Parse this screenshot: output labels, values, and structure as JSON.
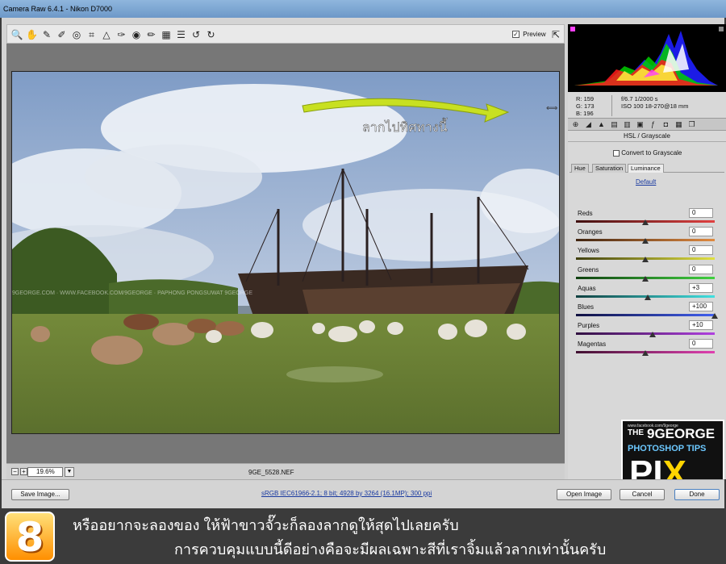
{
  "window": {
    "title": "Camera Raw 6.4.1  -  Nikon D7000"
  },
  "toolbar": {
    "tools": [
      {
        "name": "zoom-tool-icon",
        "glyph": "🔍"
      },
      {
        "name": "hand-tool-icon",
        "glyph": "✋"
      },
      {
        "name": "white-balance-tool-icon",
        "glyph": "✎"
      },
      {
        "name": "color-sampler-tool-icon",
        "glyph": "✐"
      },
      {
        "name": "targeted-adjustment-tool-icon",
        "glyph": "◎"
      },
      {
        "name": "crop-tool-icon",
        "glyph": "⌗"
      },
      {
        "name": "straighten-tool-icon",
        "glyph": "△"
      },
      {
        "name": "spot-removal-tool-icon",
        "glyph": "✑"
      },
      {
        "name": "red-eye-tool-icon",
        "glyph": "◉"
      },
      {
        "name": "adjustment-brush-icon",
        "glyph": "✏"
      },
      {
        "name": "graduated-filter-icon",
        "glyph": "▦"
      },
      {
        "name": "preferences-icon",
        "glyph": "☰"
      },
      {
        "name": "rotate-left-icon",
        "glyph": "↺"
      },
      {
        "name": "rotate-right-icon",
        "glyph": "↻"
      }
    ],
    "preview_label": "Preview",
    "preview_checked": "✓"
  },
  "annotation": {
    "text": "ลากไปทิศทางนี้"
  },
  "watermark": {
    "text": "9GEORGE.COM · WWW.FACEBOOK.COM/9GEORGE · PAPHONG PONGSUWAT 9GEORGE"
  },
  "viewer_footer": {
    "zoom_minus": "−",
    "zoom_plus": "+",
    "zoom_value": "19.6%",
    "zoom_dropdown": "▼",
    "filename": "9GE_5528.NEF"
  },
  "info": {
    "rgb": {
      "r": "R:  159",
      "g": "G:  173",
      "b": "B:  196"
    },
    "camera": {
      "line1": "f/6.7    1/2000 s",
      "line2": "ISO 100   18-270@18 mm"
    }
  },
  "panel": {
    "title": "HSL / Grayscale",
    "convert_label": "Convert to Grayscale",
    "tabs": [
      "Hue",
      "Saturation",
      "Luminance"
    ],
    "default_link": "Default",
    "sliders": [
      {
        "label": "Reds",
        "value": "0",
        "pos": 0.5,
        "track": "linear-gradient(90deg,#401010,#e04040)"
      },
      {
        "label": "Oranges",
        "value": "0",
        "pos": 0.5,
        "track": "linear-gradient(90deg,#402410,#e08a40)"
      },
      {
        "label": "Yellows",
        "value": "0",
        "pos": 0.5,
        "track": "linear-gradient(90deg,#404010,#e0e040)"
      },
      {
        "label": "Greens",
        "value": "0",
        "pos": 0.5,
        "track": "linear-gradient(90deg,#104010,#40d040)"
      },
      {
        "label": "Aquas",
        "value": "+3",
        "pos": 0.515,
        "track": "linear-gradient(90deg,#104040,#40e0e0)"
      },
      {
        "label": "Blues",
        "value": "+100",
        "pos": 1.0,
        "track": "linear-gradient(90deg,#101040,#4060f0)"
      },
      {
        "label": "Purples",
        "value": "+10",
        "pos": 0.55,
        "track": "linear-gradient(90deg,#301040,#b040e0)"
      },
      {
        "label": "Magentas",
        "value": "0",
        "pos": 0.5,
        "track": "linear-gradient(90deg,#401030,#e040b0)"
      }
    ]
  },
  "bottom": {
    "save_button": "Save Image...",
    "workflow_link": "sRGB IEC61966-2.1; 8 bit; 4928 by 3264 (16.1MP); 300 ppi",
    "open_button": "Open Image",
    "cancel_button": "Cancel",
    "done_button": "Done"
  },
  "banner": {
    "step": "8",
    "line1": "หรืออยากจะลองของ ให้ฟ้าขาวจั๊วะก็ลองลากดูให้สุดไปเลยครับ",
    "line2": "การควบคุมแบบนี้ดีอย่างคือจะมีผลเฉพาะสีที่เราจิ้มแล้วลากเท่านั้นครับ"
  },
  "logo": {
    "url": "www.facebook.com/9george",
    "the": "THE",
    "name": "9GEORGE",
    "subtitle": "PHOTOSHOP TIPS",
    "pix_white": "PI",
    "pix_yellow": "X"
  },
  "colors": {
    "annotation_arrow": "#c8e021",
    "accent_link": "#1a3aa0"
  }
}
